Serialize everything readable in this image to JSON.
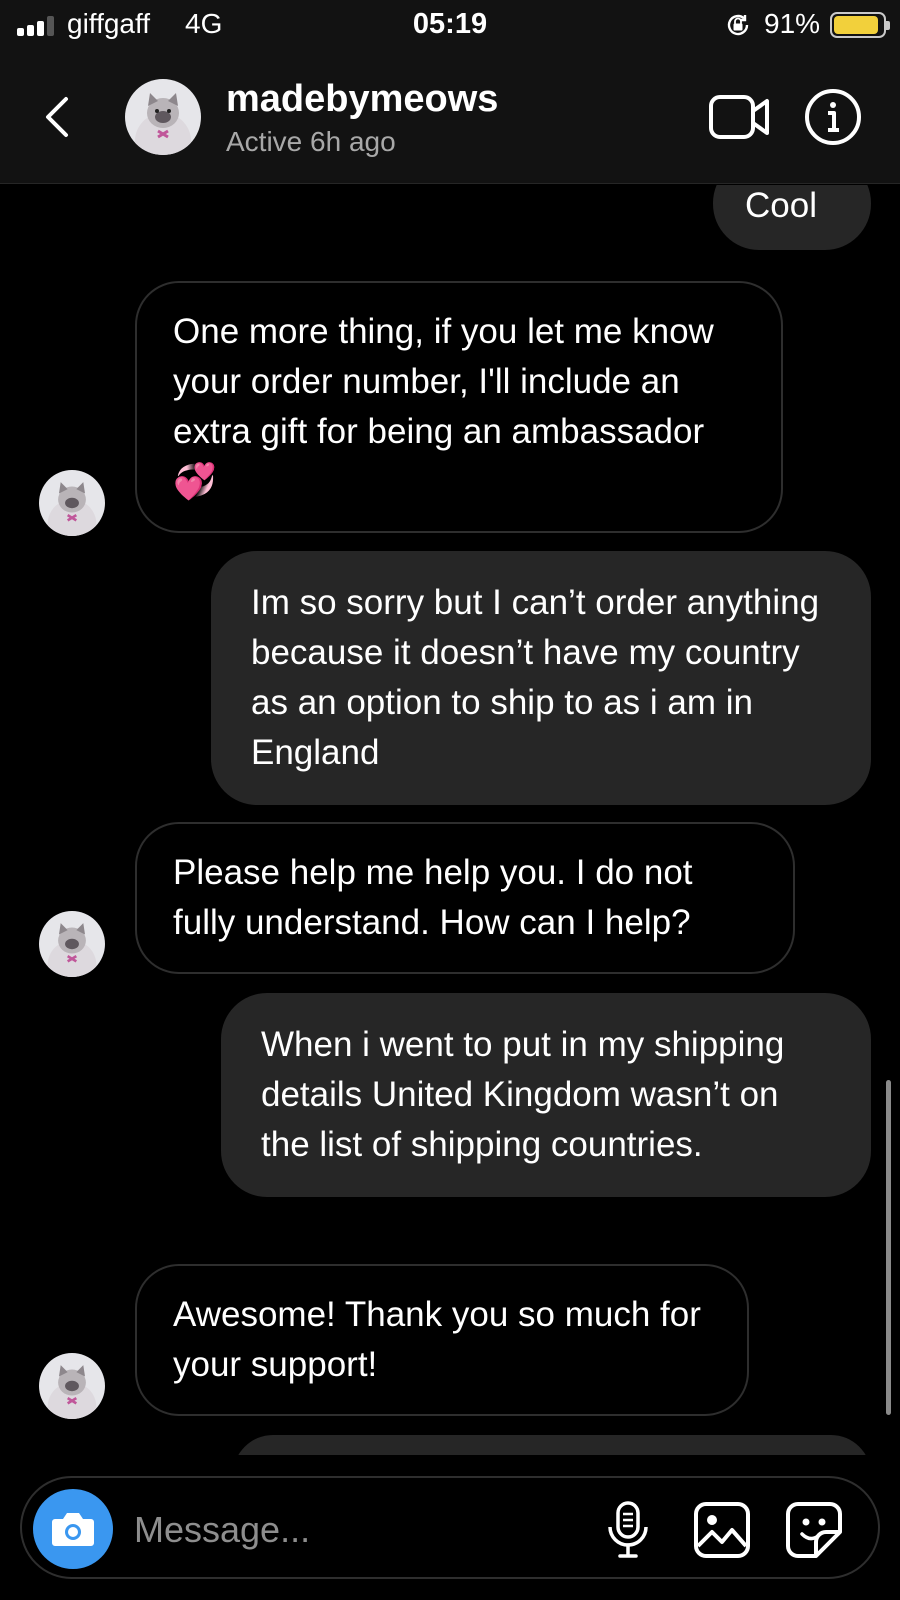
{
  "status_bar": {
    "carrier": "giffgaff",
    "network": "4G",
    "time": "05:19",
    "battery_percent": "91%",
    "battery_level": 0.91,
    "battery_color": "#f2d03b"
  },
  "header": {
    "username": "madebymeows",
    "status": "Active 6h ago",
    "icons": [
      "back-arrow-icon",
      "video-camera-icon",
      "info-icon"
    ]
  },
  "messages": [
    {
      "sender": "me",
      "text": "Cool"
    },
    {
      "sender": "them",
      "text": "One more thing, if you let me know your order number, I'll include an extra gift for being an ambassador 💞"
    },
    {
      "sender": "me",
      "text": "Im so sorry but I can’t order anything because it doesn’t have my country as an option to ship to as i am in England"
    },
    {
      "sender": "them",
      "text": "Please help me help you. I do not fully understand. How can I help?"
    },
    {
      "sender": "me",
      "text": "When i went to put in my shipping details United Kingdom wasn’t on the list of shipping countries."
    },
    {
      "sender": "them",
      "text": "Awesome! Thank you so much for your support!"
    }
  ],
  "composer": {
    "placeholder": "Message...",
    "icons": [
      "camera-icon",
      "microphone-icon",
      "gallery-icon",
      "sticker-icon"
    ],
    "accent_color": "#3a97f0"
  }
}
